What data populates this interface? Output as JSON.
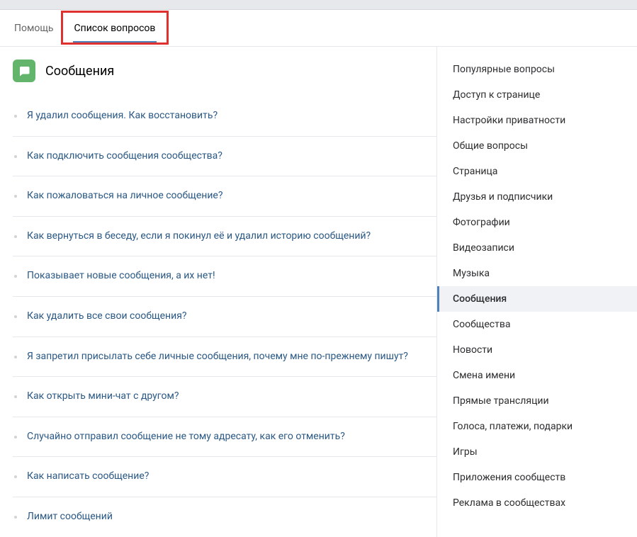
{
  "tabs": {
    "help": "Помощь",
    "questions": "Список вопросов"
  },
  "header": {
    "title": "Сообщения"
  },
  "questions": [
    "Я удалил сообщения. Как восстановить?",
    "Как подключить сообщения сообщества?",
    "Как пожаловаться на личное сообщение?",
    "Как вернуться в беседу, если я покинул её и удалил историю сообщений?",
    "Показывает новые сообщения, а их нет!",
    "Как удалить все свои сообщения?",
    "Я запретил присылать себе личные сообщения, почему мне по-прежнему пишут?",
    "Как открыть мини-чат с другом?",
    "Случайно отправил сообщение не тому адресату, как его отменить?",
    "Как написать сообщение?",
    "Лимит сообщений"
  ],
  "sidebar": [
    {
      "label": "Популярные вопросы",
      "active": false
    },
    {
      "label": "Доступ к странице",
      "active": false
    },
    {
      "label": "Настройки приватности",
      "active": false
    },
    {
      "label": "Общие вопросы",
      "active": false
    },
    {
      "label": "Страница",
      "active": false
    },
    {
      "label": "Друзья и подписчики",
      "active": false
    },
    {
      "label": "Фотографии",
      "active": false
    },
    {
      "label": "Видеозаписи",
      "active": false
    },
    {
      "label": "Музыка",
      "active": false
    },
    {
      "label": "Сообщения",
      "active": true
    },
    {
      "label": "Сообщества",
      "active": false
    },
    {
      "label": "Новости",
      "active": false
    },
    {
      "label": "Смена имени",
      "active": false
    },
    {
      "label": "Прямые трансляции",
      "active": false
    },
    {
      "label": "Голоса, платежи, подарки",
      "active": false
    },
    {
      "label": "Игры",
      "active": false
    },
    {
      "label": "Приложения сообществ",
      "active": false
    },
    {
      "label": "Реклама в сообществах",
      "active": false
    }
  ]
}
